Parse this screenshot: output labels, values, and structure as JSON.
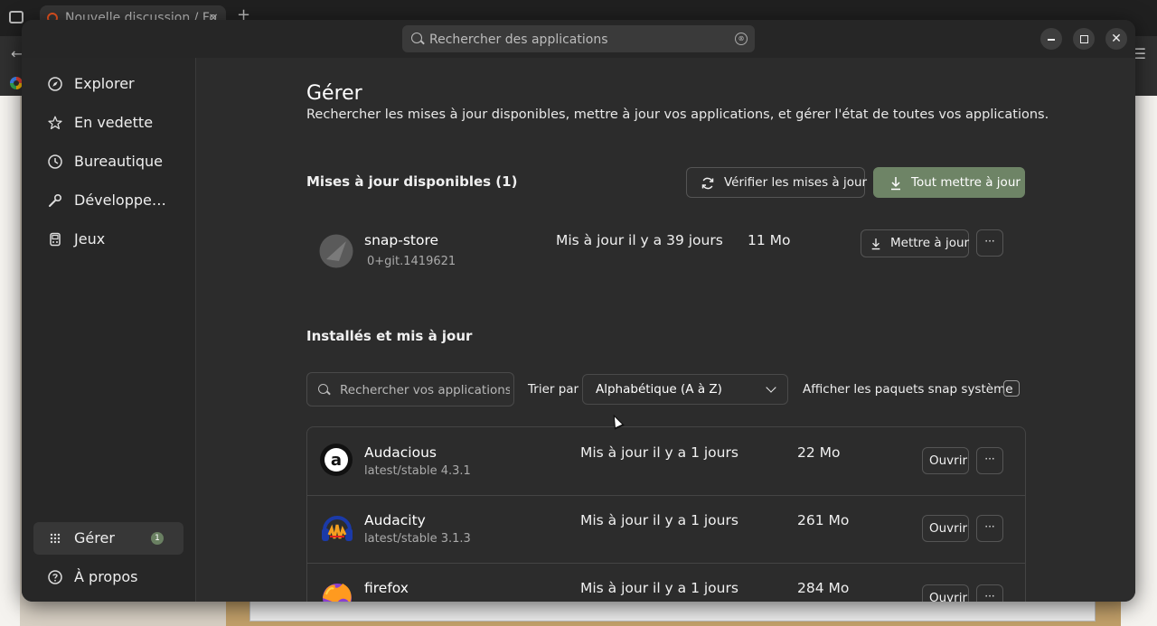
{
  "browser": {
    "tab_title": "Nouvelle discussion / Fo",
    "tab_close": "×",
    "new_tab": "+"
  },
  "search": {
    "placeholder": "Rechercher des applications",
    "clear": "⊗"
  },
  "window": {
    "close": "✕"
  },
  "sidebar": {
    "items": [
      {
        "label": "Explorer",
        "icon": "compass-icon"
      },
      {
        "label": "En vedette",
        "icon": "star-icon"
      },
      {
        "label": "Bureautique",
        "icon": "clock-icon"
      },
      {
        "label": "Développe…",
        "icon": "wrench-icon"
      },
      {
        "label": "Jeux",
        "icon": "gamepad-icon"
      }
    ],
    "manage": {
      "label": "Gérer",
      "badge": "1",
      "icon": "grid-icon"
    },
    "about": {
      "label": "À propos",
      "icon": "question-icon"
    }
  },
  "main": {
    "title": "Gérer",
    "subtitle": "Rechercher les mises à jour disponibles, mettre à jour vos applications, et gérer l'état de toutes vos applications.",
    "updates": {
      "title": "Mises à jour disponibles (1)",
      "check_label": "Vérifier les mises à jour",
      "update_all_label": "Tout mettre à jour",
      "items": [
        {
          "name": "snap-store",
          "version": "0+git.1419621",
          "date": "Mis à jour il y a 39 jours",
          "size": "11 Mo",
          "action": "Mettre à jour",
          "more": "···"
        }
      ]
    },
    "installed": {
      "title": "Installés et mis à jour",
      "search_placeholder": "Rechercher vos applications...",
      "sort_label": "Trier par",
      "sort_value": "Alphabétique (A à Z)",
      "system_label": "Afficher les paquets snap système",
      "items": [
        {
          "name": "Audacious",
          "version": "latest/stable 4.3.1",
          "date": "Mis à jour il y a 1 jours",
          "size": "22 Mo",
          "action": "Ouvrir",
          "more": "···"
        },
        {
          "name": "Audacity",
          "version": "latest/stable 3.1.3",
          "date": "Mis à jour il y a 1 jours",
          "size": "261 Mo",
          "action": "Ouvrir",
          "more": "···"
        },
        {
          "name": "firefox",
          "version": "",
          "date": "Mis à jour il y a 1 jours",
          "size": "284 Mo",
          "action": "Ouvrir",
          "more": "···"
        }
      ]
    }
  },
  "colors": {
    "accent": "#6e8466",
    "window_bg": "#2c2c2c",
    "sidebar_bg": "#272727"
  }
}
